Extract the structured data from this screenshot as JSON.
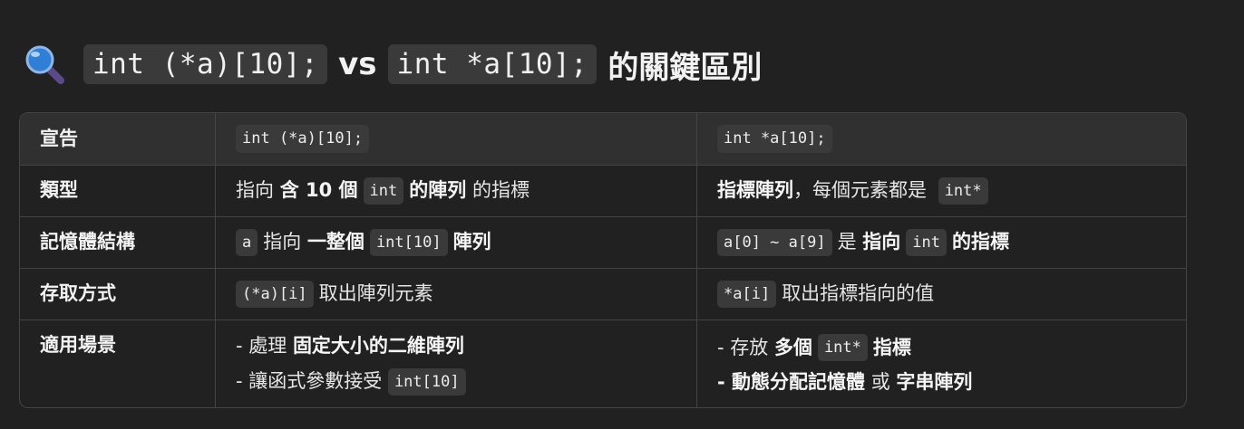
{
  "title": {
    "icon": "magnifying-glass-icon",
    "code1": "int (*a)[10];",
    "vs": "vs",
    "code2": "int *a[10];",
    "suffix": "的關鍵區別"
  },
  "table": {
    "header": {
      "label": "宣告",
      "col1": "int (*a)[10];",
      "col2": "int *a[10];"
    },
    "rows": {
      "type": {
        "label": "類型",
        "col1": {
          "p1": "指向 ",
          "b1": "含 10 個",
          "code": "int",
          "b2": "的陣列",
          "p2": " 的指標"
        },
        "col2": {
          "b1": "指標陣列",
          "p1": "，每個元素都是 ",
          "code": "int*"
        }
      },
      "memory": {
        "label": "記憶體結構",
        "col1": {
          "code1": "a",
          "p1": "指向 ",
          "b1": "一整個",
          "code2": "int[10]",
          "b2": "陣列"
        },
        "col2": {
          "code": "a[0] ~ a[9]",
          "p1": "是 ",
          "b1": "指向",
          "code2": "int",
          "b2": "的指標"
        }
      },
      "access": {
        "label": "存取方式",
        "col1": {
          "code": "(*a)[i]",
          "p1": "取出陣列元素"
        },
        "col2": {
          "code": "*a[i]",
          "p1": "取出指標指向的值"
        }
      },
      "usage": {
        "label": "適用場景",
        "col1": {
          "l1": {
            "p1": "- 處理 ",
            "b1": "固定大小的二維陣列"
          },
          "l2": {
            "p1": "- 讓函式參數接受 ",
            "code": "int[10]"
          }
        },
        "col2": {
          "l1": {
            "p1": "- 存放 ",
            "b1": "多個",
            "code": "int*",
            "b2": "指標"
          },
          "l2": {
            "b1": "- 動態分配記憶體",
            "p1": " 或 ",
            "b2": "字串陣列"
          }
        }
      }
    }
  },
  "colors": {
    "background": "#212121",
    "code_bg": "#3a3a3a",
    "header_bg": "#303030",
    "border": "#444444",
    "icon_glass": "#2f7fd6",
    "icon_handle": "#5a4a8a"
  }
}
